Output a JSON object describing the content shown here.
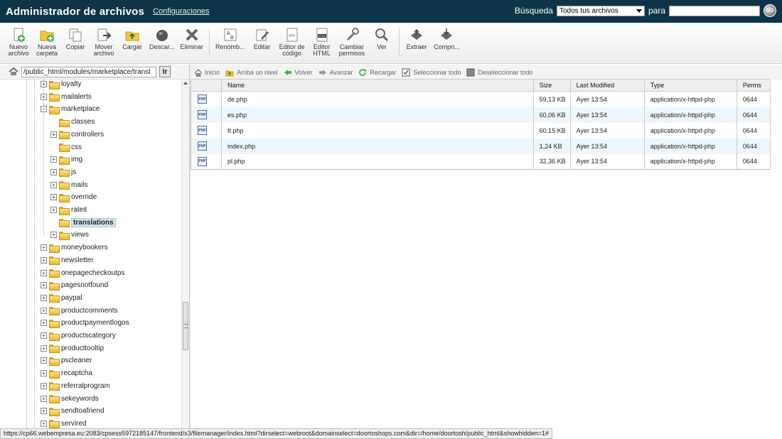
{
  "header": {
    "title": "Administrador de archivos",
    "config_link": "Configuraciones",
    "search_label": "Búsqueda",
    "search_select": "Todos tus archivos",
    "search_for": "para",
    "go_label": "GO"
  },
  "toolbar": {
    "buttons": [
      {
        "label": "Nuevo\narchivo",
        "icon": "new-file-icon"
      },
      {
        "label": "Nueva\ncarpeta",
        "icon": "new-folder-icon"
      },
      {
        "label": "Copiar",
        "icon": "copy-icon"
      },
      {
        "label": "Mover\narchivo",
        "icon": "move-icon"
      },
      {
        "label": "Cargar",
        "icon": "upload-icon"
      },
      {
        "label": "Descar...",
        "icon": "download-icon"
      },
      {
        "label": "Eliminar",
        "icon": "delete-icon"
      },
      {
        "label": "Renomb...",
        "icon": "rename-icon"
      },
      {
        "label": "Editar",
        "icon": "edit-icon"
      },
      {
        "label": "Editor de\ncódigo",
        "icon": "code-editor-icon"
      },
      {
        "label": "Editor\nHTML",
        "icon": "html-editor-icon"
      },
      {
        "label": "Cambiar\npermisos",
        "icon": "permissions-icon"
      },
      {
        "label": "Ver",
        "icon": "view-icon"
      },
      {
        "label": "Extraer",
        "icon": "extract-icon"
      },
      {
        "label": "Compri...",
        "icon": "compress-icon"
      }
    ]
  },
  "path": {
    "value": "/public_html/modules/marketplace/transl",
    "go_label": "Ir"
  },
  "nav": {
    "items": [
      {
        "label": "Inicio",
        "icon": "home-icon"
      },
      {
        "label": "Arriba un nivel",
        "icon": "up-level-icon"
      },
      {
        "label": "Volver",
        "icon": "back-arrow-icon"
      },
      {
        "label": "Avanzar",
        "icon": "forward-arrow-icon"
      },
      {
        "label": "Recargar",
        "icon": "reload-icon"
      },
      {
        "label": "Seleccionar todo",
        "icon": "select-all-icon"
      },
      {
        "label": "Deseleccionar todo",
        "icon": "deselect-all-icon"
      }
    ]
  },
  "tree": {
    "items": [
      {
        "label": "loyalty",
        "level": 0,
        "toggle": "+"
      },
      {
        "label": "mailalerts",
        "level": 0,
        "toggle": "+"
      },
      {
        "label": "marketplace",
        "level": 0,
        "toggle": "-",
        "open": true
      },
      {
        "label": "classes",
        "level": 1,
        "toggle": ""
      },
      {
        "label": "controllers",
        "level": 1,
        "toggle": "+"
      },
      {
        "label": "css",
        "level": 1,
        "toggle": ""
      },
      {
        "label": "img",
        "level": 1,
        "toggle": "+"
      },
      {
        "label": "js",
        "level": 1,
        "toggle": "+"
      },
      {
        "label": "mails",
        "level": 1,
        "toggle": "+"
      },
      {
        "label": "override",
        "level": 1,
        "toggle": "+"
      },
      {
        "label": "rateit",
        "level": 1,
        "toggle": "+"
      },
      {
        "label": "translations",
        "level": 1,
        "toggle": "",
        "selected": true
      },
      {
        "label": "views",
        "level": 1,
        "toggle": "+"
      },
      {
        "label": "moneybookers",
        "level": 0,
        "toggle": "+"
      },
      {
        "label": "newsletter",
        "level": 0,
        "toggle": "+"
      },
      {
        "label": "onepagecheckoutps",
        "level": 0,
        "toggle": "+"
      },
      {
        "label": "pagesnotfound",
        "level": 0,
        "toggle": "+"
      },
      {
        "label": "paypal",
        "level": 0,
        "toggle": "+"
      },
      {
        "label": "productcomments",
        "level": 0,
        "toggle": "+"
      },
      {
        "label": "productpaymentlogos",
        "level": 0,
        "toggle": "+"
      },
      {
        "label": "productscategory",
        "level": 0,
        "toggle": "+"
      },
      {
        "label": "producttooltip",
        "level": 0,
        "toggle": "+"
      },
      {
        "label": "pscleaner",
        "level": 0,
        "toggle": "+"
      },
      {
        "label": "recaptcha",
        "level": 0,
        "toggle": "+"
      },
      {
        "label": "referralprogram",
        "level": 0,
        "toggle": "+"
      },
      {
        "label": "sekeywords",
        "level": 0,
        "toggle": "+"
      },
      {
        "label": "sendtoafriend",
        "level": 0,
        "toggle": "+"
      },
      {
        "label": "servired",
        "level": 0,
        "toggle": "+"
      }
    ]
  },
  "files": {
    "columns": [
      "Name",
      "Size",
      "Last Modified",
      "Type",
      "Perms"
    ],
    "icon_label": "PHP",
    "rows": [
      {
        "name": "de.php",
        "size": "59,13 KB",
        "modified": "Ayer 13:54",
        "type": "application/x-httpd-php",
        "perms": "0644"
      },
      {
        "name": "es.php",
        "size": "60,06 KB",
        "modified": "Ayer 13:54",
        "type": "application/x-httpd-php",
        "perms": "0644"
      },
      {
        "name": "fr.php",
        "size": "60,15 KB",
        "modified": "Ayer 13:54",
        "type": "application/x-httpd-php",
        "perms": "0644"
      },
      {
        "name": "index.php",
        "size": "1,24 KB",
        "modified": "Ayer 13:54",
        "type": "application/x-httpd-php",
        "perms": "0644"
      },
      {
        "name": "pl.php",
        "size": "32,36 KB",
        "modified": "Ayer 13:54",
        "type": "application/x-httpd-php",
        "perms": "0644"
      }
    ]
  },
  "status": {
    "url": "https://cp66.webempresa.eu:2083/cpsess5972185147/frontend/x3/filemanager/index.html?dirselect=webroot&domainselect=doortoshops.com&dir=/home/doortosh/public_html&showhidden=1#"
  },
  "colors": {
    "header_bg": "#0d3547",
    "selected_bg": "#cfe6ec",
    "alt_row_bg": "#eef6fb"
  }
}
